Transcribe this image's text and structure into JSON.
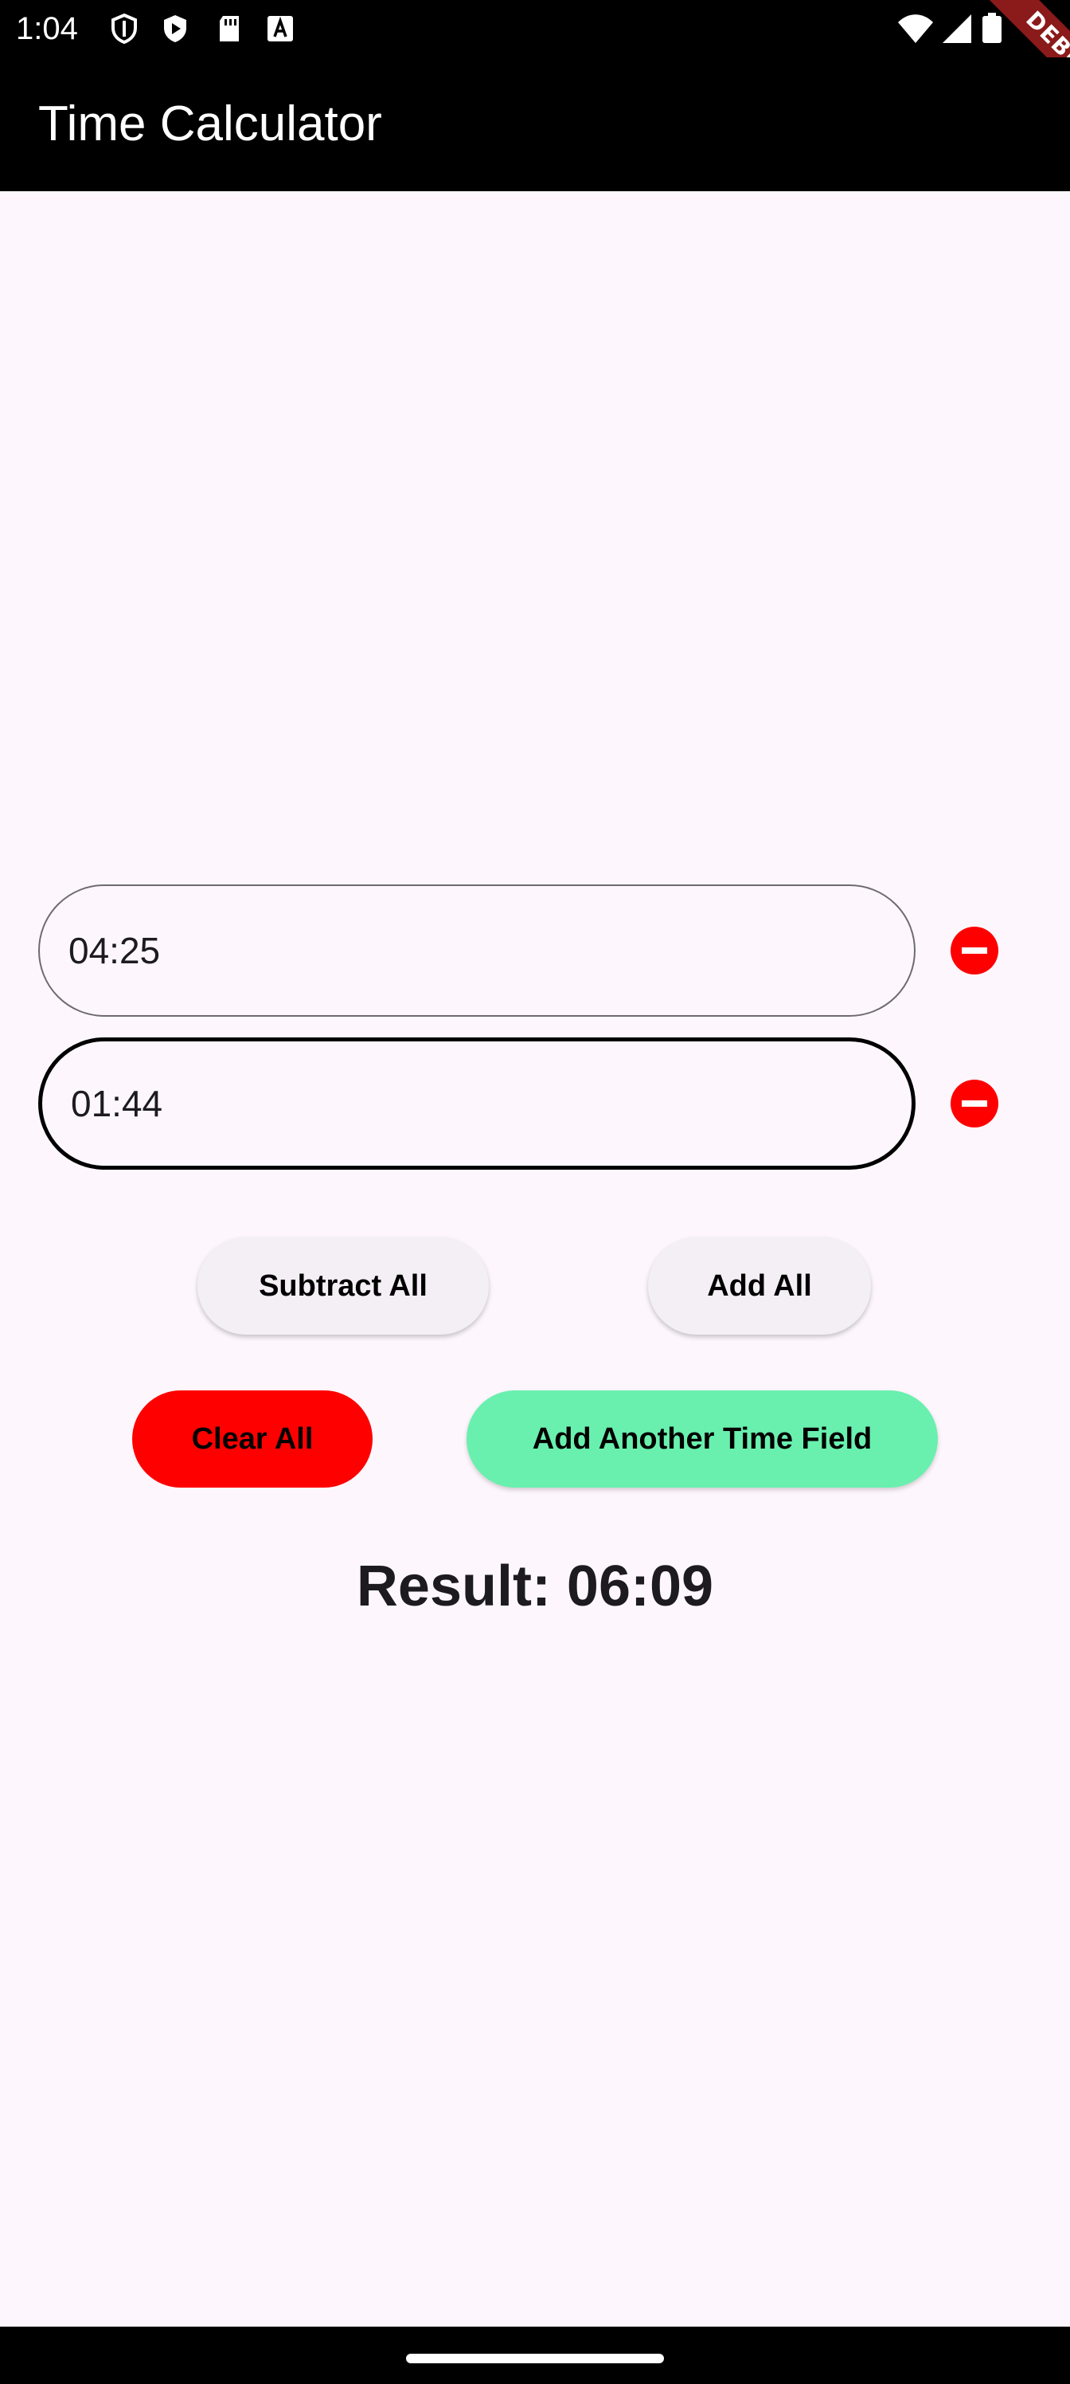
{
  "status_bar": {
    "time": "1:04",
    "icons": [
      "shield-icon",
      "play-protect-icon",
      "sd-card-icon",
      "font-icon"
    ],
    "right_icons": [
      "wifi-icon",
      "signal-icon",
      "battery-icon"
    ]
  },
  "app_bar": {
    "title": "Time Calculator"
  },
  "debug_banner": {
    "label": "DEBUG",
    "color": "#8b1a1a"
  },
  "time_fields": [
    {
      "value": "04:25",
      "state": "idle"
    },
    {
      "value": "01:44",
      "state": "focused"
    }
  ],
  "actions": {
    "subtract_all": "Subtract All",
    "add_all": "Add All",
    "clear_all": "Clear All",
    "add_field": "Add Another Time Field"
  },
  "result": {
    "text": "Result: 06:09"
  },
  "colors": {
    "background": "#fdf7fd",
    "app_bar": "#000000",
    "remove_icon": "#ff0000",
    "clear_button": "#ff0000",
    "add_field_button": "#69f0ae"
  }
}
